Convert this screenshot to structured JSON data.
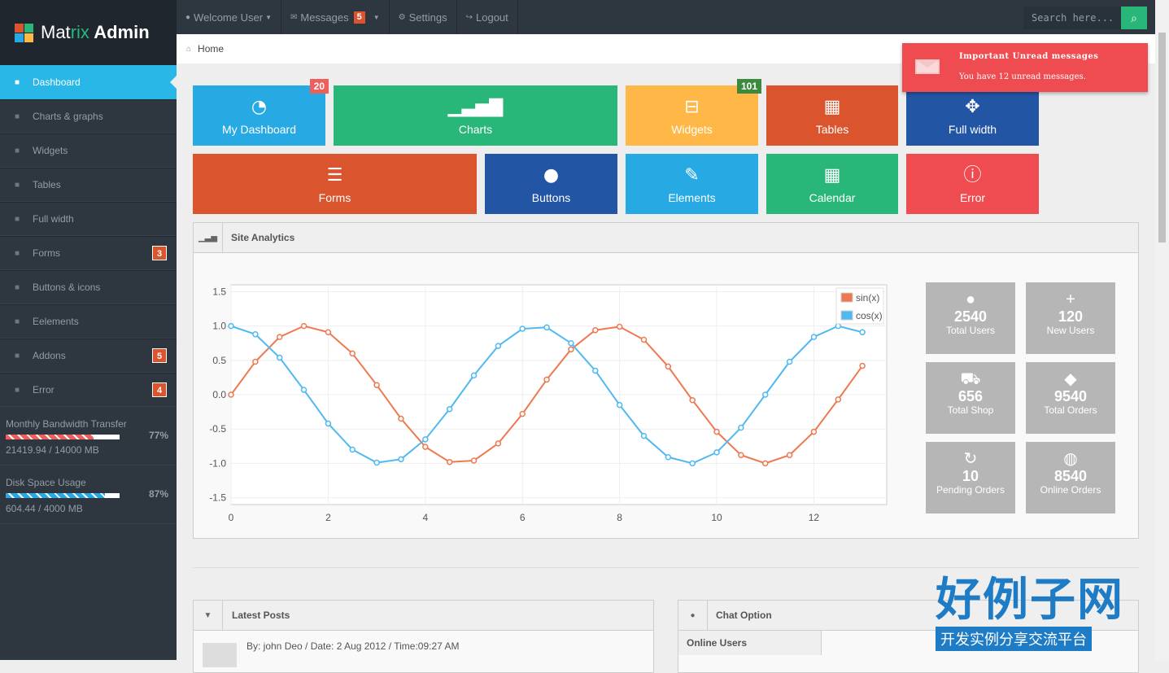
{
  "sidebar": {
    "logo_a": "Mat",
    "logo_b": "rix",
    "logo_c": " Admin",
    "items": [
      {
        "label": "Dashboard",
        "icon": "home-icon",
        "badge": ""
      },
      {
        "label": "Charts & graphs",
        "icon": "signal-icon",
        "badge": ""
      },
      {
        "label": "Widgets",
        "icon": "inbox-icon",
        "badge": ""
      },
      {
        "label": "Tables",
        "icon": "table-icon",
        "badge": ""
      },
      {
        "label": "Full width",
        "icon": "fullscreen-icon",
        "badge": ""
      },
      {
        "label": "Forms",
        "icon": "list-icon",
        "badge": "3"
      },
      {
        "label": "Buttons & icons",
        "icon": "tint-icon",
        "badge": ""
      },
      {
        "label": "Eelements",
        "icon": "pencil-icon",
        "badge": ""
      },
      {
        "label": "Addons",
        "icon": "file-icon",
        "badge": "5"
      },
      {
        "label": "Error",
        "icon": "info-icon",
        "badge": "4"
      }
    ],
    "meters": [
      {
        "label": "Monthly Bandwidth Transfer",
        "value": "21419.94 / 14000 MB",
        "percent": "77%",
        "fill": 0.77,
        "color": "#ee5f5b"
      },
      {
        "label": "Disk Space Usage",
        "value": "604.44 / 4000 MB",
        "percent": "87%",
        "fill": 0.87,
        "color": "#27a9e3"
      }
    ]
  },
  "topbar": {
    "welcome": "Welcome User",
    "messages": "Messages",
    "messages_badge": "5",
    "settings": "Settings",
    "logout": "Logout",
    "search_placeholder": "Search here..."
  },
  "breadcrumb": {
    "home": "Home"
  },
  "notice": {
    "title": "Important Unread messages",
    "text": "You have 12 unread messages."
  },
  "tiles": [
    {
      "label": "My Dashboard",
      "icon": "dashboard-icon",
      "glyph": "◔",
      "color": "#27a9e3",
      "badge": "20",
      "badge_color": "#ee5f5b"
    },
    {
      "label": "Charts",
      "icon": "signal-icon",
      "glyph": "▁▃▅▇",
      "color": "#28b779",
      "badge": "",
      "badge_color": ""
    },
    {
      "label": "Widgets",
      "icon": "inbox-icon",
      "glyph": "⊟",
      "color": "#ffb848",
      "badge": "101",
      "badge_color": "#3b8a3d"
    },
    {
      "label": "Tables",
      "icon": "table-icon",
      "glyph": "▦",
      "color": "#da542e",
      "badge": "",
      "badge_color": ""
    },
    {
      "label": "Full width",
      "icon": "fullscreen-icon",
      "glyph": "✥",
      "color": "#2255a4",
      "badge": "",
      "badge_color": ""
    },
    {
      "label": "Forms",
      "icon": "list-icon",
      "glyph": "☰",
      "color": "#da542e",
      "badge": "",
      "badge_color": ""
    },
    {
      "label": "Buttons",
      "icon": "tint-icon",
      "glyph": "●",
      "color": "#2255a4",
      "badge": "",
      "badge_color": ""
    },
    {
      "label": "Elements",
      "icon": "pencil-icon",
      "glyph": "✎",
      "color": "#27a9e3",
      "badge": "",
      "badge_color": ""
    },
    {
      "label": "Calendar",
      "icon": "calendar-icon",
      "glyph": "▦",
      "color": "#28b779",
      "badge": "",
      "badge_color": ""
    },
    {
      "label": "Error",
      "icon": "info-icon",
      "glyph": "ⓘ",
      "color": "#ee4c50",
      "badge": "",
      "badge_color": ""
    }
  ],
  "site_analytics": {
    "title": "Site Analytics",
    "stats": [
      {
        "value": "2540",
        "label": "Total Users",
        "icon": "user-icon",
        "glyph": "●"
      },
      {
        "value": "120",
        "label": "New Users",
        "icon": "plus-icon",
        "glyph": "+"
      },
      {
        "value": "656",
        "label": "Total Shop",
        "icon": "cart-icon",
        "glyph": "⛟"
      },
      {
        "value": "9540",
        "label": "Total Orders",
        "icon": "tag-icon",
        "glyph": "◆"
      },
      {
        "value": "10",
        "label": "Pending Orders",
        "icon": "repeat-icon",
        "glyph": "↻"
      },
      {
        "value": "8540",
        "label": "Online Orders",
        "icon": "globe-icon",
        "glyph": "◍"
      }
    ]
  },
  "chart_data": {
    "type": "line",
    "title": "",
    "xlabel": "",
    "ylabel": "",
    "xlim": [
      0,
      13.5
    ],
    "ylim": [
      -1.6,
      1.6
    ],
    "x_ticks": [
      0,
      2,
      4,
      6,
      8,
      10,
      12
    ],
    "y_ticks": [
      1.5,
      1.0,
      0.5,
      0.0,
      -0.5,
      -1.0,
      -1.5
    ],
    "y_tick_labels": [
      "1.5",
      "1.0",
      "0.5",
      "0.0",
      "-0.5",
      "-1.0",
      "-1.5"
    ],
    "legend": "top-right",
    "grid": true,
    "x": [
      0,
      0.5,
      1,
      1.5,
      2,
      2.5,
      3,
      3.5,
      4,
      4.5,
      5,
      5.5,
      6,
      6.5,
      7,
      7.5,
      8,
      8.5,
      9,
      9.5,
      10,
      10.5,
      11,
      11.5,
      12,
      12.5,
      13
    ],
    "series": [
      {
        "name": "sin(x)",
        "color": "#ee7951",
        "values": [
          0,
          0.48,
          0.84,
          1.0,
          0.91,
          0.6,
          0.14,
          -0.35,
          -0.76,
          -0.98,
          -0.96,
          -0.71,
          -0.28,
          0.22,
          0.66,
          0.94,
          0.99,
          0.8,
          0.41,
          -0.08,
          -0.54,
          -0.88,
          -1.0,
          -0.88,
          -0.54,
          -0.07,
          0.42
        ]
      },
      {
        "name": "cos(x)",
        "color": "#4fb9f0",
        "values": [
          1.0,
          0.88,
          0.54,
          0.07,
          -0.42,
          -0.8,
          -0.99,
          -0.94,
          -0.65,
          -0.21,
          0.28,
          0.71,
          0.96,
          0.98,
          0.75,
          0.35,
          -0.15,
          -0.6,
          -0.91,
          -1.0,
          -0.84,
          -0.48,
          0.0,
          0.48,
          0.84,
          1.0,
          0.91
        ]
      }
    ]
  },
  "latest_posts": {
    "title": "Latest Posts",
    "meta": "By: john Deo / Date: 2 Aug 2012 / Time:09:27 AM"
  },
  "chat": {
    "title": "Chat Option",
    "online": "Online Users"
  },
  "watermark": {
    "big": "好例子网",
    "small": "开发实例分享交流平台"
  }
}
